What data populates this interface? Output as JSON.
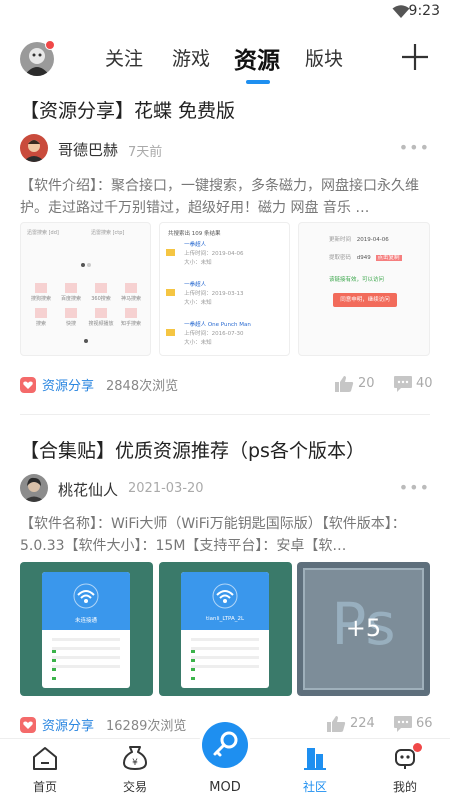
{
  "status": {
    "time": "9:23"
  },
  "nav": {
    "tabs": [
      {
        "label": "关注"
      },
      {
        "label": "游戏"
      },
      {
        "label": "资源"
      },
      {
        "label": "版块"
      }
    ]
  },
  "posts": [
    {
      "title": "【资源分享】花蝶 免费版",
      "author": "哥德巴赫",
      "time": "7天前",
      "body": "【软件介绍】：聚合接口，一键搜索，多条磁力，网盘接口永久维护。走过路过千万别错过，超级好用！磁力 网盘 音乐 …",
      "tag": "资源分享",
      "views": "2848次浏览",
      "likes": "20",
      "comments": "40",
      "img1": {
        "search_left": "迅雷搜索 [dd]",
        "search_right": "迅雷搜索 [ctp]",
        "grid": [
          "搜狗搜索",
          "百度搜索",
          "360搜索",
          "神马搜索",
          "搜索",
          "快搜",
          "搜视频播放",
          "知乎搜索"
        ]
      },
      "img2": {
        "result_count": "共搜索出 109 条结果",
        "items": [
          {
            "title": "一拳超人",
            "date": "上传时间：2019-04-06",
            "size": "大小：未知"
          },
          {
            "title": "一拳超人",
            "date": "上传时间：2019-03-13",
            "size": "大小：未知"
          },
          {
            "title": "一拳超人 One Punch Man",
            "date": "上传时间：2016-07-30",
            "size": "大小：未知"
          }
        ]
      },
      "img3": {
        "update_label": "更新时间",
        "update_value": "2019-04-06",
        "code_label": "提取密码",
        "code_value": "d949",
        "copy_label": "点击复制",
        "note": "该链接有效，可以访问",
        "button": "同意申明，继续访问"
      }
    },
    {
      "title": "【合集贴】优质资源推荐（ps各个版本）",
      "author": "桃花仙人",
      "time": "2021-03-20",
      "body": "【软件名称】：WiFi大师（WiFi万能钥匙国际版）【软件版本】：5.0.33【软件大小】：15M【支持平台】：安卓【软…",
      "tag": "资源分享",
      "views": "16289次浏览",
      "likes": "224",
      "comments": "66",
      "img1": {
        "ssid": "未连接通"
      },
      "img2": {
        "ssid": "tianli_LTPA_2L"
      },
      "img3": {
        "logo": "Ps",
        "more_count": "+5"
      }
    }
  ],
  "bottom_nav": [
    {
      "label": "首页"
    },
    {
      "label": "交易"
    },
    {
      "label": "MOD"
    },
    {
      "label": "社区"
    },
    {
      "label": "我的"
    }
  ],
  "colors": {
    "accent": "#1e8ff0",
    "tag": "#f46a6a",
    "badge": "#f04848"
  }
}
